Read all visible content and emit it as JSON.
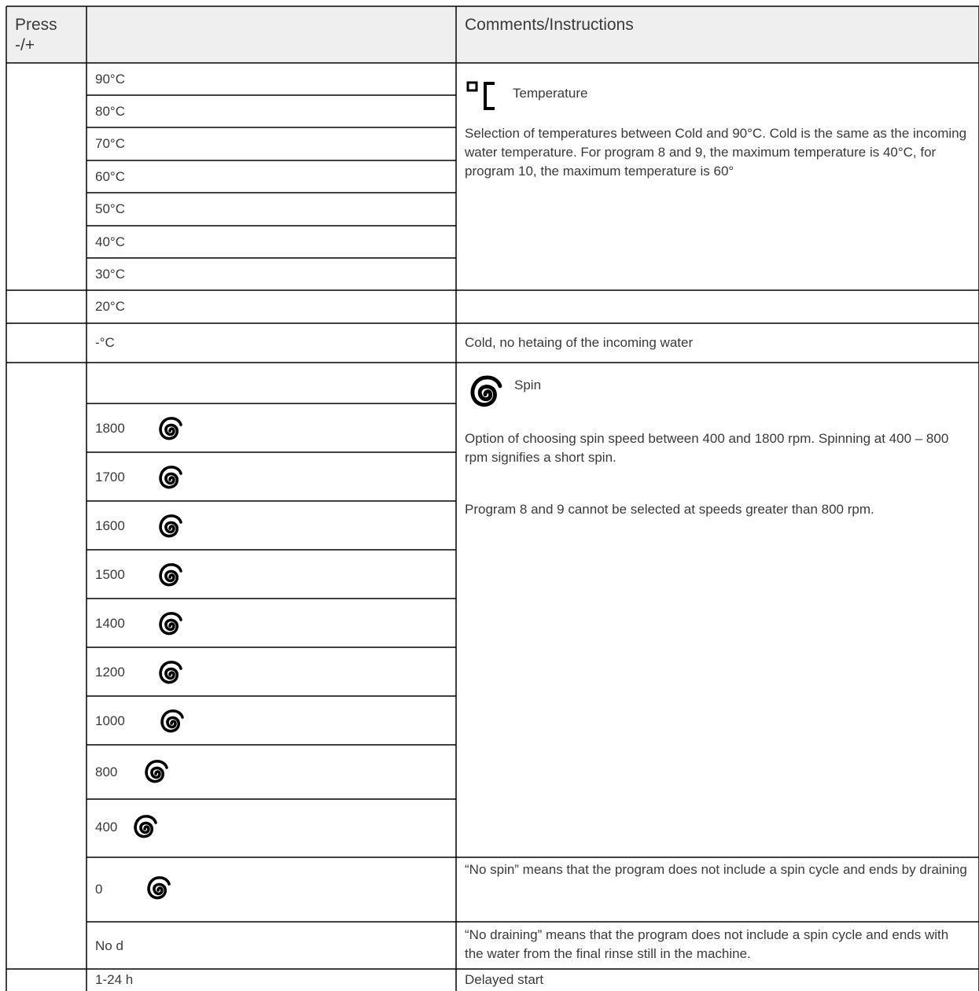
{
  "header": {
    "col1": "Press -/+",
    "col2": "",
    "col3": "Comments/Instructions"
  },
  "temperatures": [
    "90°C",
    "80°C",
    "70°C",
    "60°C",
    "50°C",
    "40°C",
    "30°C"
  ],
  "temp20": "20°C",
  "tempCold": "-°C",
  "tempSection": {
    "title": "Temperature",
    "icon": "degree-celsius-icon",
    "description": "Selection of temperatures between Cold and 90°C. Cold is the same as the incoming water temperature. For program 8 and 9, the maximum temperature is 40°C, for program 10, the maximum temperature is 60°"
  },
  "coldComment": "Cold, no hetaing of the incoming water",
  "spinSection": {
    "title": "Spin",
    "icon": "spin-spiral-icon",
    "description1": "Option of choosing spin speed between 400 and 1800 rpm. Spinning at 400 – 800 rpm signifies a short spin.",
    "description2": "Program 8 and 9 cannot be selected at speeds greater than 800 rpm."
  },
  "spinSpeeds": [
    "1800",
    "1700",
    "1600",
    "1500",
    "1400",
    "1200",
    "1000",
    "800",
    "400"
  ],
  "noSpin": {
    "label": "0",
    "comment": "“No spin” means that the program does not include a spin cycle and ends by draining"
  },
  "noDrain": {
    "label": "No d",
    "comment": "“No draining” means that the program does not include a spin cycle and ends with the water from the final rinse still in the machine."
  },
  "delay": {
    "label": "1-24 h",
    "comment": "Delayed start"
  },
  "colors": {
    "border": "#000000",
    "header_bg": "#efefef",
    "text": "#3a3a3a"
  }
}
